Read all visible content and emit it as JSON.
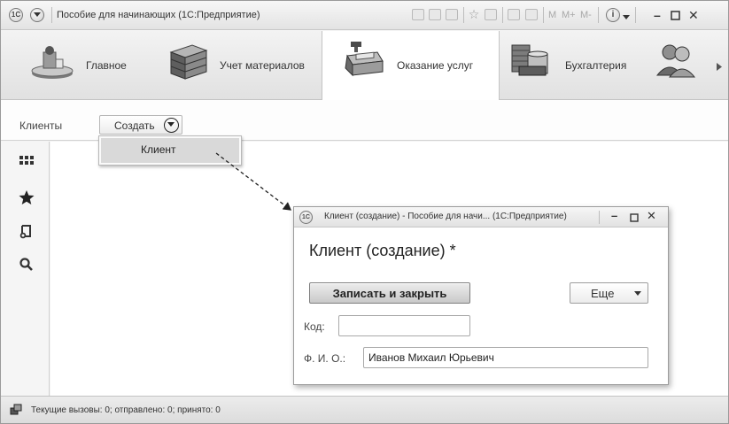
{
  "window": {
    "logo": "1C",
    "title": "Пособие для начинающих  (1С:Предприятие)",
    "memory_buttons": [
      "M",
      "M+",
      "M-"
    ]
  },
  "sections": [
    {
      "label": "Главное",
      "icon": "home-desk-icon"
    },
    {
      "label": "Учет материалов",
      "icon": "bricks-icon"
    },
    {
      "label": "Оказание услуг",
      "icon": "cash-register-icon",
      "active": true
    },
    {
      "label": "Бухгалтерия",
      "icon": "coins-icon"
    }
  ],
  "command_bar": {
    "title": "Клиенты",
    "create_label": "Создать"
  },
  "dropdown": {
    "item": "Клиент"
  },
  "modal": {
    "logo": "1C",
    "window_title": "Клиент (создание) - Пособие для начи... (1С:Предприятие)",
    "heading": "Клиент (создание) *",
    "save_close_label": "Записать и закрыть",
    "more_label": "Еще",
    "code_label": "Код:",
    "code_value": "",
    "name_label": "Ф. И. О.:",
    "name_value": "Иванов Михаил Юрьевич"
  },
  "status": {
    "text": "Текущие вызовы: 0; отправлено: 0; принято: 0"
  }
}
